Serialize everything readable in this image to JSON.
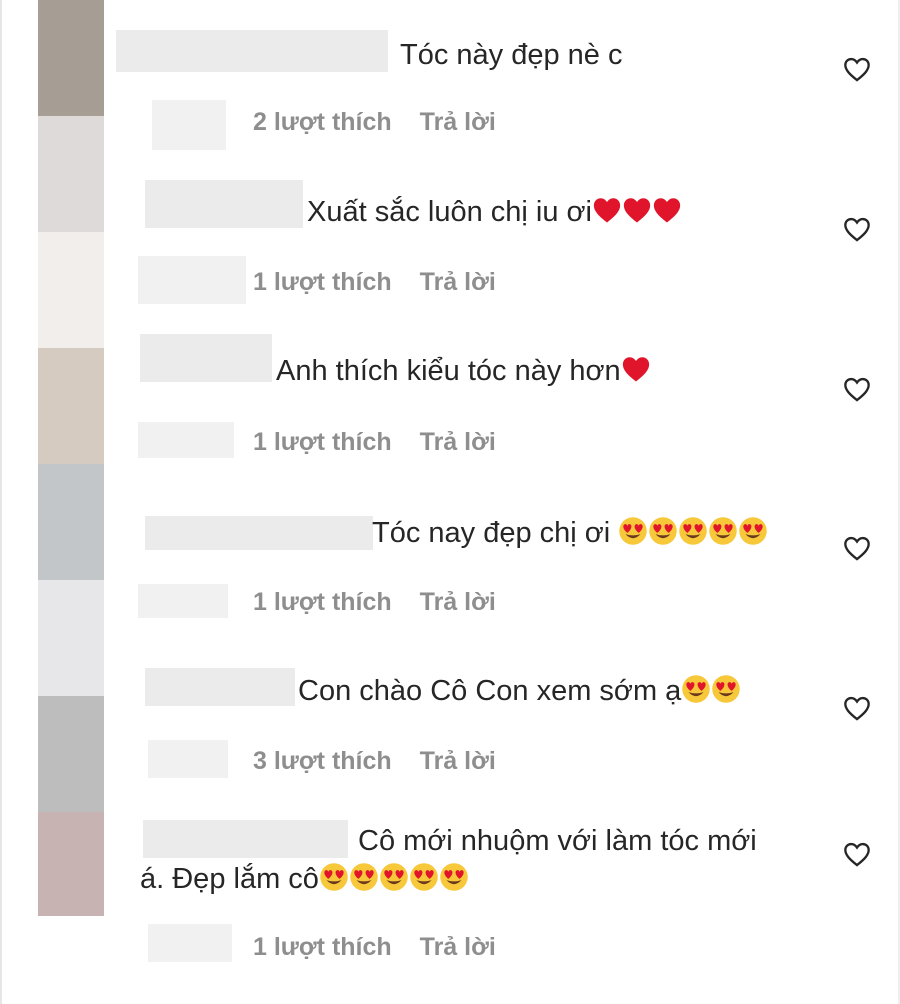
{
  "comments": [
    {
      "text": "Tóc này đẹp nè c",
      "emojis": [],
      "likes": "2 lượt thích",
      "reply": "Trả lời"
    },
    {
      "text": "Xuất sắc luôn chị iu ơi",
      "emojis": [
        "heart",
        "heart",
        "heart"
      ],
      "likes": "1 lượt thích",
      "reply": "Trả lời"
    },
    {
      "text": "Anh thích kiểu tóc này hơn",
      "emojis": [
        "heart"
      ],
      "likes": "1 lượt thích",
      "reply": "Trả lời"
    },
    {
      "text": "Tóc nay đẹp chị ơi ",
      "emojis": [
        "heart-eyes",
        "heart-eyes",
        "heart-eyes",
        "heart-eyes",
        "heart-eyes"
      ],
      "likes": "1 lượt thích",
      "reply": "Trả lời"
    },
    {
      "text": "Con chào Cô Con xem sớm ạ",
      "emojis": [
        "heart-eyes",
        "heart-eyes"
      ],
      "likes": "3 lượt thích",
      "reply": "Trả lời"
    },
    {
      "text": "Cô mới nhuộm với làm tóc mới",
      "text2": "á. Đẹp lắm cô",
      "emojis": [
        "heart-eyes",
        "heart-eyes",
        "heart-eyes",
        "heart-eyes",
        "heart-eyes"
      ],
      "likes": "1 lượt thích",
      "reply": "Trả lời"
    }
  ],
  "icons": {
    "like": "heart-outline-icon",
    "emoji_heart": "red-heart-emoji",
    "emoji_heart_eyes": "heart-eyes-emoji"
  },
  "colors": {
    "text": "#262626",
    "meta": "#8e8e8e",
    "heart_emoji": "#e0152b",
    "face_emoji": "#f7c83a"
  }
}
